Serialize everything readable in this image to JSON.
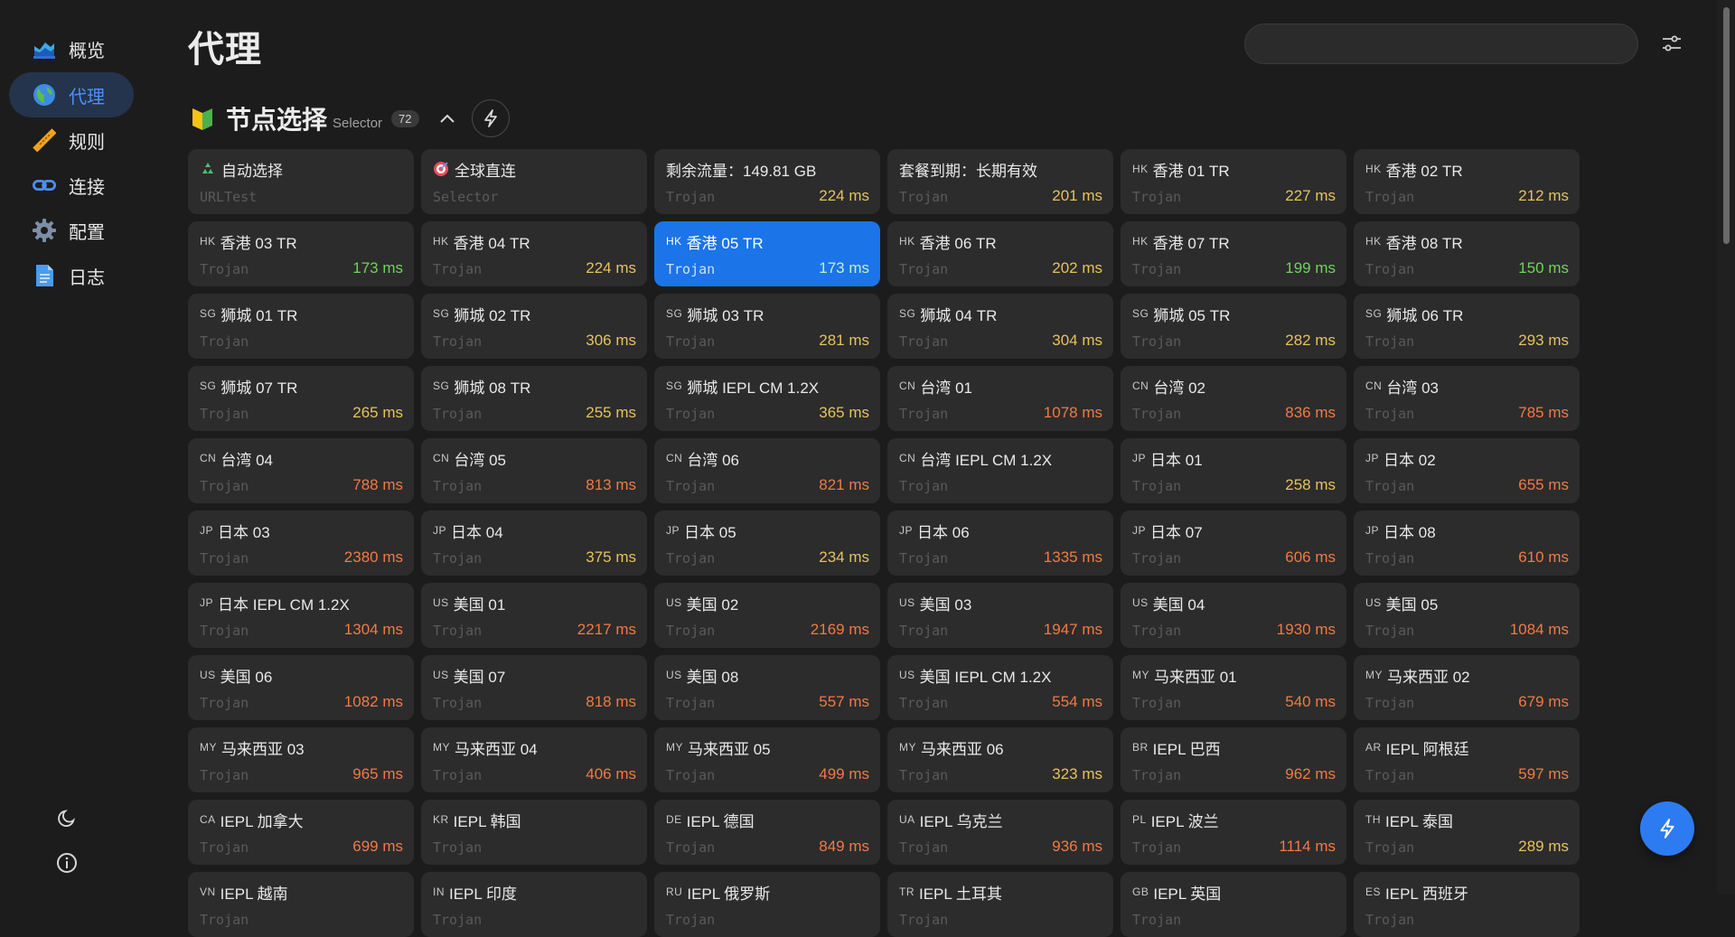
{
  "sidebar": {
    "items": [
      {
        "label": "概览",
        "icon": "chart-area-icon"
      },
      {
        "label": "代理",
        "icon": "globe-icon"
      },
      {
        "label": "规则",
        "icon": "ruler-icon"
      },
      {
        "label": "连接",
        "icon": "link-icon"
      },
      {
        "label": "配置",
        "icon": "gear-icon"
      },
      {
        "label": "日志",
        "icon": "document-icon"
      }
    ],
    "active_index": 1
  },
  "page": {
    "title": "代理"
  },
  "search": {
    "placeholder": "",
    "value": ""
  },
  "group": {
    "name": "节点选择",
    "type": "Selector",
    "count": "72"
  },
  "colors": {
    "accent": "#1b74e8",
    "delay_good": "#6fd35b",
    "delay_medium": "#e6c25e",
    "delay_slow": "#f07a47"
  },
  "proxies": [
    {
      "tag": "",
      "emoji": "recycle-icon",
      "name": "自动选择",
      "type": "URLTest",
      "delay": "",
      "level": ""
    },
    {
      "tag": "",
      "emoji": "target-icon",
      "name": "全球直连",
      "type": "Selector",
      "delay": "",
      "level": ""
    },
    {
      "tag": "",
      "name": "剩余流量：149.81 GB",
      "type": "Trojan",
      "delay": "224 ms",
      "level": "medium"
    },
    {
      "tag": "",
      "name": "套餐到期：长期有效",
      "type": "Trojan",
      "delay": "201 ms",
      "level": "medium"
    },
    {
      "tag": "HK",
      "name": "香港 01 TR",
      "type": "Trojan",
      "delay": "227 ms",
      "level": "medium"
    },
    {
      "tag": "HK",
      "name": "香港 02 TR",
      "type": "Trojan",
      "delay": "212 ms",
      "level": "medium"
    },
    {
      "tag": "HK",
      "name": "香港 03 TR",
      "type": "Trojan",
      "delay": "173 ms",
      "level": "good"
    },
    {
      "tag": "HK",
      "name": "香港 04 TR",
      "type": "Trojan",
      "delay": "224 ms",
      "level": "medium"
    },
    {
      "tag": "HK",
      "name": "香港 05 TR",
      "type": "Trojan",
      "delay": "173 ms",
      "level": "good",
      "selected": true
    },
    {
      "tag": "HK",
      "name": "香港 06 TR",
      "type": "Trojan",
      "delay": "202 ms",
      "level": "medium"
    },
    {
      "tag": "HK",
      "name": "香港 07 TR",
      "type": "Trojan",
      "delay": "199 ms",
      "level": "good"
    },
    {
      "tag": "HK",
      "name": "香港 08 TR",
      "type": "Trojan",
      "delay": "150 ms",
      "level": "good"
    },
    {
      "tag": "SG",
      "name": "狮城 01 TR",
      "type": "Trojan",
      "delay": "",
      "level": ""
    },
    {
      "tag": "SG",
      "name": "狮城 02 TR",
      "type": "Trojan",
      "delay": "306 ms",
      "level": "medium"
    },
    {
      "tag": "SG",
      "name": "狮城 03 TR",
      "type": "Trojan",
      "delay": "281 ms",
      "level": "medium"
    },
    {
      "tag": "SG",
      "name": "狮城 04 TR",
      "type": "Trojan",
      "delay": "304 ms",
      "level": "medium"
    },
    {
      "tag": "SG",
      "name": "狮城 05 TR",
      "type": "Trojan",
      "delay": "282 ms",
      "level": "medium"
    },
    {
      "tag": "SG",
      "name": "狮城 06 TR",
      "type": "Trojan",
      "delay": "293 ms",
      "level": "medium"
    },
    {
      "tag": "SG",
      "name": "狮城 07 TR",
      "type": "Trojan",
      "delay": "265 ms",
      "level": "medium"
    },
    {
      "tag": "SG",
      "name": "狮城 08 TR",
      "type": "Trojan",
      "delay": "255 ms",
      "level": "medium"
    },
    {
      "tag": "SG",
      "name": "狮城 IEPL CM 1.2X",
      "type": "Trojan",
      "delay": "365 ms",
      "level": "medium"
    },
    {
      "tag": "CN",
      "name": "台湾 01",
      "type": "Trojan",
      "delay": "1078 ms",
      "level": "slow"
    },
    {
      "tag": "CN",
      "name": "台湾 02",
      "type": "Trojan",
      "delay": "836 ms",
      "level": "slow"
    },
    {
      "tag": "CN",
      "name": "台湾 03",
      "type": "Trojan",
      "delay": "785 ms",
      "level": "slow"
    },
    {
      "tag": "CN",
      "name": "台湾 04",
      "type": "Trojan",
      "delay": "788 ms",
      "level": "slow"
    },
    {
      "tag": "CN",
      "name": "台湾 05",
      "type": "Trojan",
      "delay": "813 ms",
      "level": "slow"
    },
    {
      "tag": "CN",
      "name": "台湾 06",
      "type": "Trojan",
      "delay": "821 ms",
      "level": "slow"
    },
    {
      "tag": "CN",
      "name": "台湾 IEPL CM 1.2X",
      "type": "Trojan",
      "delay": "",
      "level": ""
    },
    {
      "tag": "JP",
      "name": "日本 01",
      "type": "Trojan",
      "delay": "258 ms",
      "level": "medium"
    },
    {
      "tag": "JP",
      "name": "日本 02",
      "type": "Trojan",
      "delay": "655 ms",
      "level": "slow"
    },
    {
      "tag": "JP",
      "name": "日本 03",
      "type": "Trojan",
      "delay": "2380 ms",
      "level": "slow"
    },
    {
      "tag": "JP",
      "name": "日本 04",
      "type": "Trojan",
      "delay": "375 ms",
      "level": "medium"
    },
    {
      "tag": "JP",
      "name": "日本 05",
      "type": "Trojan",
      "delay": "234 ms",
      "level": "medium"
    },
    {
      "tag": "JP",
      "name": "日本 06",
      "type": "Trojan",
      "delay": "1335 ms",
      "level": "slow"
    },
    {
      "tag": "JP",
      "name": "日本 07",
      "type": "Trojan",
      "delay": "606 ms",
      "level": "slow"
    },
    {
      "tag": "JP",
      "name": "日本 08",
      "type": "Trojan",
      "delay": "610 ms",
      "level": "slow"
    },
    {
      "tag": "JP",
      "name": "日本 IEPL CM 1.2X",
      "type": "Trojan",
      "delay": "1304 ms",
      "level": "slow"
    },
    {
      "tag": "US",
      "name": "美国 01",
      "type": "Trojan",
      "delay": "2217 ms",
      "level": "slow"
    },
    {
      "tag": "US",
      "name": "美国 02",
      "type": "Trojan",
      "delay": "2169 ms",
      "level": "slow"
    },
    {
      "tag": "US",
      "name": "美国 03",
      "type": "Trojan",
      "delay": "1947 ms",
      "level": "slow"
    },
    {
      "tag": "US",
      "name": "美国 04",
      "type": "Trojan",
      "delay": "1930 ms",
      "level": "slow"
    },
    {
      "tag": "US",
      "name": "美国 05",
      "type": "Trojan",
      "delay": "1084 ms",
      "level": "slow"
    },
    {
      "tag": "US",
      "name": "美国 06",
      "type": "Trojan",
      "delay": "1082 ms",
      "level": "slow"
    },
    {
      "tag": "US",
      "name": "美国 07",
      "type": "Trojan",
      "delay": "818 ms",
      "level": "slow"
    },
    {
      "tag": "US",
      "name": "美国 08",
      "type": "Trojan",
      "delay": "557 ms",
      "level": "slow"
    },
    {
      "tag": "US",
      "name": "美国 IEPL CM 1.2X",
      "type": "Trojan",
      "delay": "554 ms",
      "level": "slow"
    },
    {
      "tag": "MY",
      "name": "马来西亚 01",
      "type": "Trojan",
      "delay": "540 ms",
      "level": "slow"
    },
    {
      "tag": "MY",
      "name": "马来西亚 02",
      "type": "Trojan",
      "delay": "679 ms",
      "level": "slow"
    },
    {
      "tag": "MY",
      "name": "马来西亚 03",
      "type": "Trojan",
      "delay": "965 ms",
      "level": "slow"
    },
    {
      "tag": "MY",
      "name": "马来西亚 04",
      "type": "Trojan",
      "delay": "406 ms",
      "level": "slow"
    },
    {
      "tag": "MY",
      "name": "马来西亚 05",
      "type": "Trojan",
      "delay": "499 ms",
      "level": "slow"
    },
    {
      "tag": "MY",
      "name": "马来西亚 06",
      "type": "Trojan",
      "delay": "323 ms",
      "level": "medium"
    },
    {
      "tag": "BR",
      "name": "IEPL 巴西",
      "type": "Trojan",
      "delay": "962 ms",
      "level": "slow"
    },
    {
      "tag": "AR",
      "name": "IEPL 阿根廷",
      "type": "Trojan",
      "delay": "597 ms",
      "level": "slow"
    },
    {
      "tag": "CA",
      "name": "IEPL 加拿大",
      "type": "Trojan",
      "delay": "699 ms",
      "level": "slow"
    },
    {
      "tag": "KR",
      "name": "IEPL 韩国",
      "type": "Trojan",
      "delay": "",
      "level": ""
    },
    {
      "tag": "DE",
      "name": "IEPL 德国",
      "type": "Trojan",
      "delay": "849 ms",
      "level": "slow"
    },
    {
      "tag": "UA",
      "name": "IEPL 乌克兰",
      "type": "Trojan",
      "delay": "936 ms",
      "level": "slow"
    },
    {
      "tag": "PL",
      "name": "IEPL 波兰",
      "type": "Trojan",
      "delay": "1114 ms",
      "level": "slow"
    },
    {
      "tag": "TH",
      "name": "IEPL 泰国",
      "type": "Trojan",
      "delay": "289 ms",
      "level": "medium"
    },
    {
      "tag": "VN",
      "name": "IEPL 越南",
      "type": "Trojan",
      "delay": "",
      "level": ""
    },
    {
      "tag": "IN",
      "name": "IEPL 印度",
      "type": "Trojan",
      "delay": "",
      "level": ""
    },
    {
      "tag": "RU",
      "name": "IEPL 俄罗斯",
      "type": "Trojan",
      "delay": "",
      "level": ""
    },
    {
      "tag": "TR",
      "name": "IEPL 土耳其",
      "type": "Trojan",
      "delay": "",
      "level": ""
    },
    {
      "tag": "GB",
      "name": "IEPL 英国",
      "type": "Trojan",
      "delay": "",
      "level": ""
    },
    {
      "tag": "ES",
      "name": "IEPL 西班牙",
      "type": "Trojan",
      "delay": "",
      "level": ""
    }
  ]
}
